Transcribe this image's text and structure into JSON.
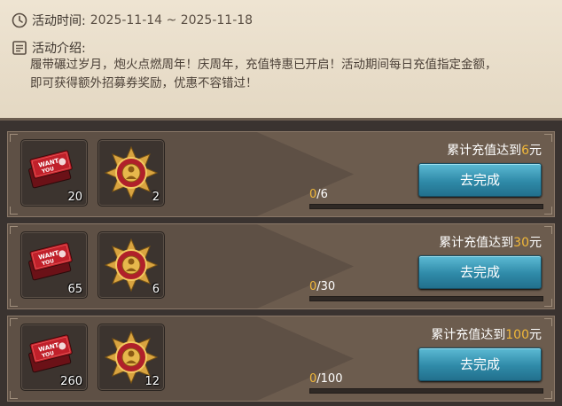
{
  "event": {
    "time_label": "活动时间:",
    "time_value": "2025-11-14 ~ 2025-11-18",
    "intro_label": "活动介绍:",
    "intro_line1": "履带碾过岁月，炮火点燃周年！庆周年，充值特惠已开启！活动期间每日充值指定金额，",
    "intro_line2": "即可获得额外招募券奖励，优惠不容错过！"
  },
  "icons": {
    "time": "clock-icon",
    "intro": "document-icon",
    "ticket": "recruit-ticket-icon",
    "medal": "medal-icon"
  },
  "colors": {
    "accent": "#f1b83a",
    "button": "#2f8aa8"
  },
  "tasks": [
    {
      "goal_prefix": "累计充值达到",
      "goal_amount": "6",
      "goal_suffix": "元",
      "button": "去完成",
      "progress_current": "0",
      "progress_total": "/6",
      "progress_fraction": 0,
      "rewards": [
        {
          "icon": "recruit-ticket-icon",
          "qty": "20"
        },
        {
          "icon": "medal-icon",
          "qty": "2"
        }
      ]
    },
    {
      "goal_prefix": "累计充值达到",
      "goal_amount": "30",
      "goal_suffix": "元",
      "button": "去完成",
      "progress_current": "0",
      "progress_total": "/30",
      "progress_fraction": 0,
      "rewards": [
        {
          "icon": "recruit-ticket-icon",
          "qty": "65"
        },
        {
          "icon": "medal-icon",
          "qty": "6"
        }
      ]
    },
    {
      "goal_prefix": "累计充值达到",
      "goal_amount": "100",
      "goal_suffix": "元",
      "button": "去完成",
      "progress_current": "0",
      "progress_total": "/100",
      "progress_fraction": 0,
      "rewards": [
        {
          "icon": "recruit-ticket-icon",
          "qty": "260"
        },
        {
          "icon": "medal-icon",
          "qty": "12"
        }
      ]
    }
  ]
}
